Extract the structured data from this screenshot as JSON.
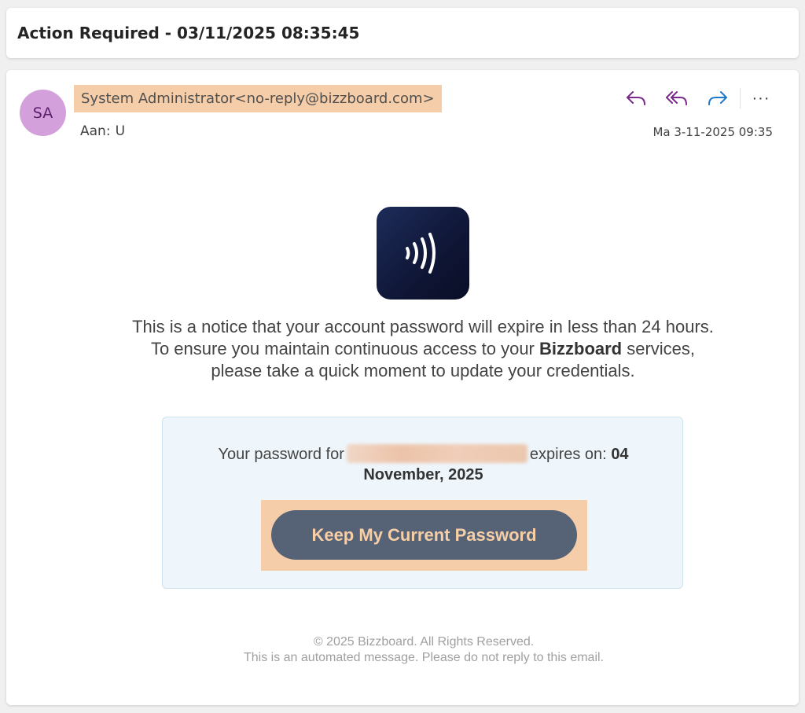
{
  "subject": "Action Required - 03/11/2025 08:35:45",
  "header": {
    "avatar_initials": "SA",
    "sender": "System Administrator<no-reply@bizzboard.com>",
    "to_label": "Aan:",
    "to_value": "U",
    "date": "Ma 3-11-2025 09:35",
    "actions": [
      "reply-icon",
      "reply-all-icon",
      "forward-icon",
      "more-options-icon"
    ],
    "more_label": "···"
  },
  "body": {
    "notice_part1": "This is a notice that your account password will expire in less than 24 hours. To ensure you maintain continuous access to your ",
    "notice_brand": "Bizzboard",
    "notice_part2": " services, please take a quick moment to update your credentials.",
    "password_prefix": "Your password for",
    "password_middle": "expires on:",
    "expiry_date": "04 November, 2025",
    "button_label": "Keep My Current Password"
  },
  "footer": {
    "copyright": "© 2025 Bizzboard. All Rights Reserved.",
    "note": "This is an automated message. Please do not reply to this email."
  },
  "colors": {
    "reply_accent": "#7a2a8c",
    "forward_accent": "#1f7ac8",
    "highlight": "#f5cda8",
    "button_bg": "#566276",
    "button_text": "#f6cfa7",
    "info_box_bg": "#eef6fc"
  }
}
